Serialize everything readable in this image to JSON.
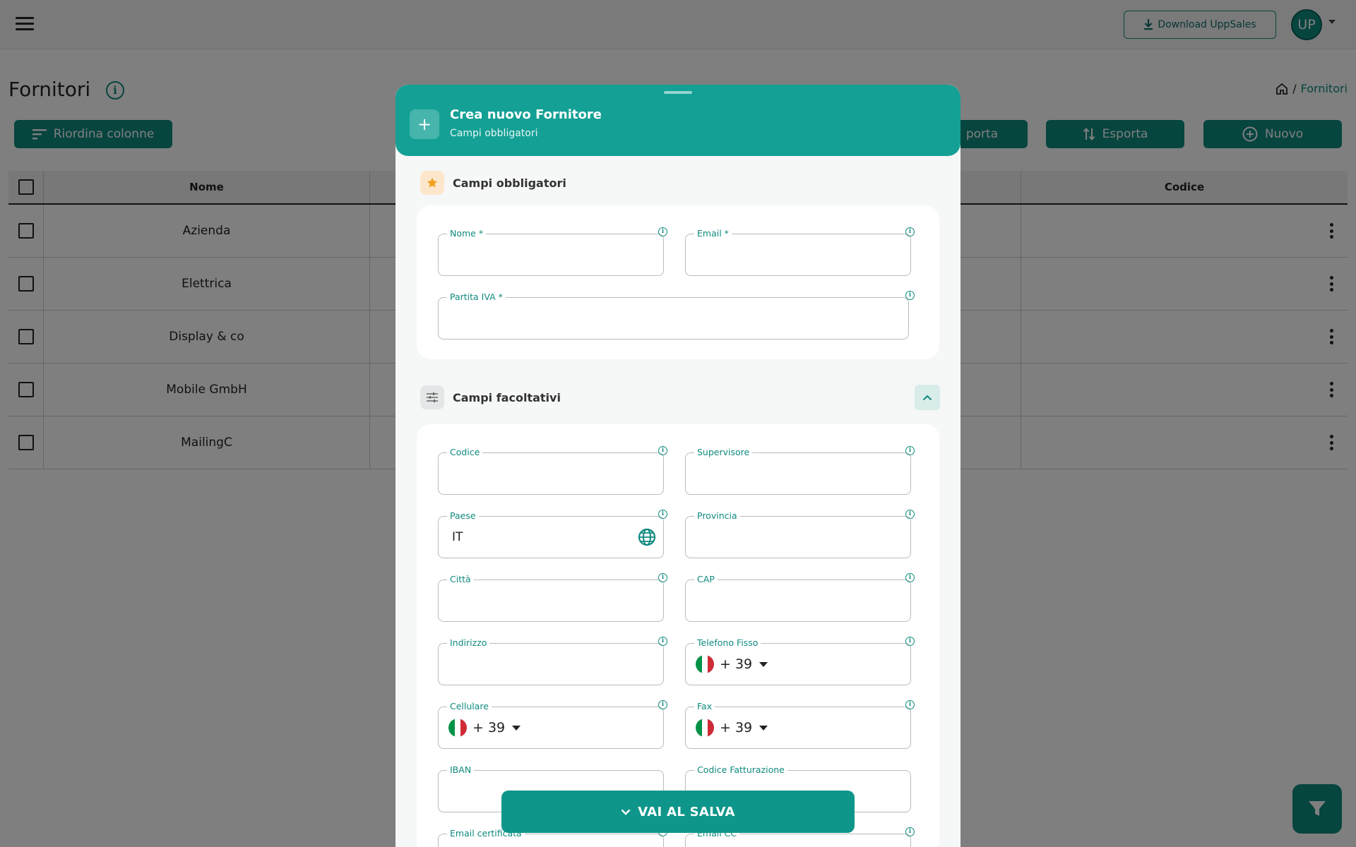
{
  "topbar": {
    "download_label": "Download UppSales",
    "avatar_initials": "UP"
  },
  "page": {
    "title": "Fornitori",
    "breadcrumb_sep": "/",
    "breadcrumb_current": "Fornitori"
  },
  "toolbar": {
    "reorder_label": "Riordina colonne",
    "import_label": "porta",
    "export_label": "Esporta",
    "new_label": "Nuovo"
  },
  "table": {
    "columns": [
      "Nome",
      "Codice"
    ],
    "rows": [
      "Azienda",
      "Elettrica",
      "Display & co",
      "Mobile GmbH",
      "MailingC"
    ]
  },
  "modal": {
    "title": "Crea nuovo Fornitore",
    "subtitle": "Campi obbligatori",
    "required_section": {
      "title": "Campi obbligatori",
      "fields": {
        "nome": "Nome *",
        "email": "Email *",
        "partita_iva": "Partita IVA *"
      }
    },
    "optional_section": {
      "title": "Campi facoltativi",
      "fields": {
        "codice": "Codice",
        "supervisore": "Supervisore",
        "paese": "Paese",
        "paese_value": "IT",
        "provincia": "Provincia",
        "citta": "Città",
        "cap": "CAP",
        "indirizzo": "Indirizzo",
        "telefono_fisso": "Telefono Fisso",
        "cellulare": "Cellulare",
        "fax": "Fax",
        "iban": "IBAN",
        "codice_fatturazione": "Codice Fatturazione",
        "email_certificata": "Email certificata",
        "email_cc": "Email CC"
      },
      "phone_prefix": "+ 39"
    },
    "save_label": "VAI AL SALVA"
  },
  "colors": {
    "accent": "#0f8a7e",
    "header": "#14a095",
    "flag_green": "#009246",
    "flag_white": "#ffffff",
    "flag_red": "#ce2b37"
  }
}
